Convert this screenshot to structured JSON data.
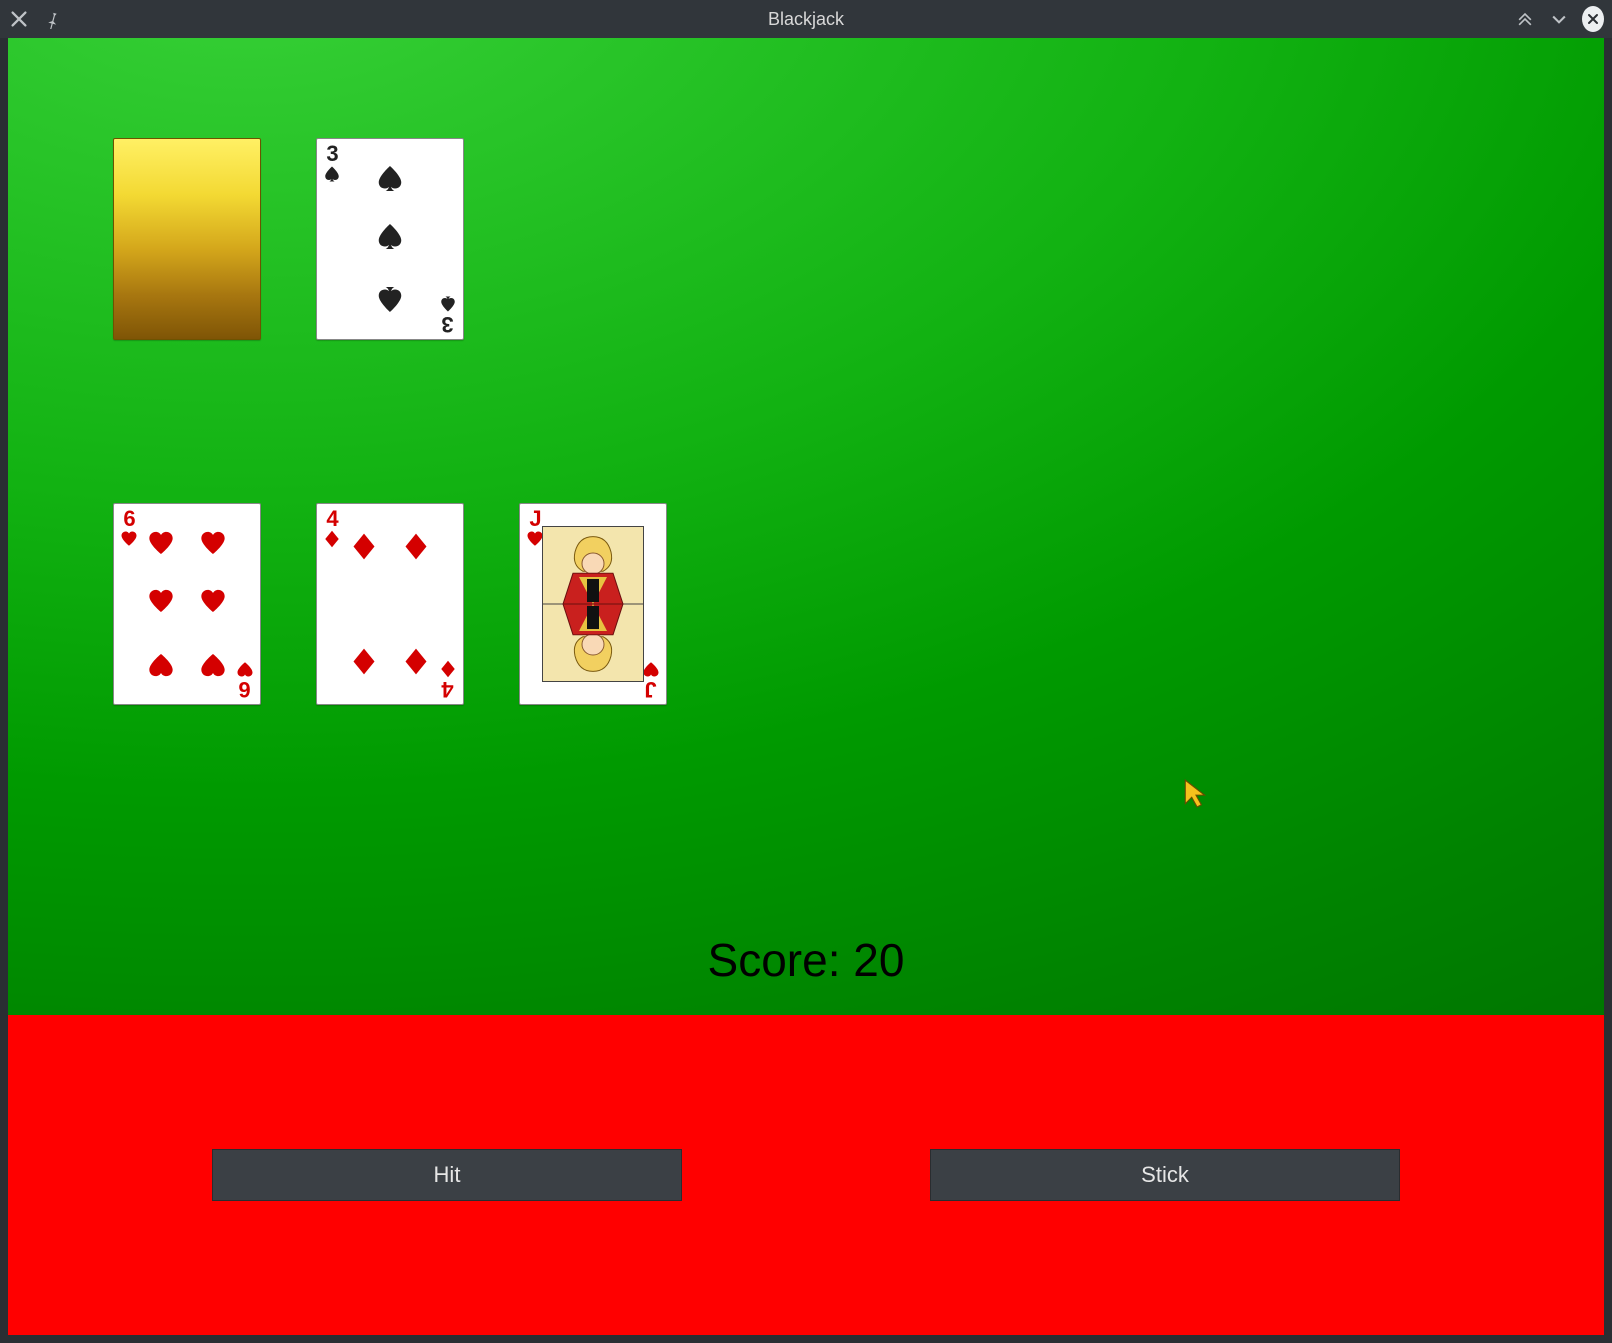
{
  "window": {
    "title": "Blackjack"
  },
  "score": {
    "label": "Score:",
    "value": "20"
  },
  "buttons": {
    "hit": "Hit",
    "stick": "Stick"
  },
  "dealer_cards": [
    {
      "hidden": true
    },
    {
      "rank": "3",
      "suit": "spades",
      "color": "black"
    }
  ],
  "player_cards": [
    {
      "rank": "6",
      "suit": "hearts",
      "color": "red"
    },
    {
      "rank": "4",
      "suit": "diamonds",
      "color": "red"
    },
    {
      "rank": "J",
      "suit": "hearts",
      "color": "red"
    }
  ]
}
